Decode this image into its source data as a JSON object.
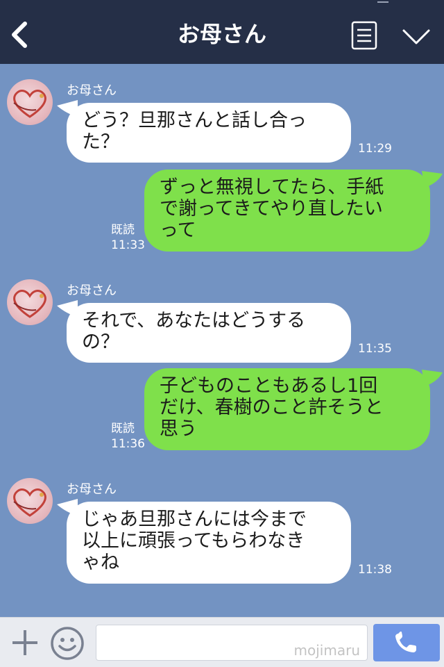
{
  "header": {
    "title": "お母さん"
  },
  "messages": [
    {
      "side": "in",
      "sender": "お母さん",
      "lines": [
        "どう？旦那さんと話し合っ",
        "た？"
      ],
      "time": "11:29"
    },
    {
      "side": "out",
      "read": "既読",
      "lines": [
        "ずっと無視してたら、手紙",
        "で謝ってきてやり直したい",
        "って"
      ],
      "time": "11:33"
    },
    {
      "side": "in",
      "sender": "お母さん",
      "lines": [
        "それで、あなたはどうする",
        "の？"
      ],
      "time": "11:35"
    },
    {
      "side": "out",
      "read": "既読",
      "lines": [
        "子どものこともあるし1回",
        "だけ、春樹のこと許そうと",
        "思う"
      ],
      "time": "11:36"
    },
    {
      "side": "in",
      "sender": "お母さん",
      "lines": [
        "じゃあ旦那さんには今まで",
        "以上に頑張ってもらわなき",
        "ゃね"
      ],
      "time": "11:38"
    }
  ],
  "input": {
    "placeholder": "",
    "watermark": "mojimaru"
  },
  "icons": {
    "back": "chevron-left-icon",
    "menu": "list-icon",
    "collapse": "chevron-down-icon",
    "plus": "plus-icon",
    "emoji": "smiley-icon",
    "call": "phone-icon"
  },
  "colors": {
    "header_bg": "#252f47",
    "chat_bg": "#7393c2",
    "incoming_bubble": "#ffffff",
    "outgoing_bubble": "#7fe04b",
    "call_button": "#6e95e6"
  }
}
